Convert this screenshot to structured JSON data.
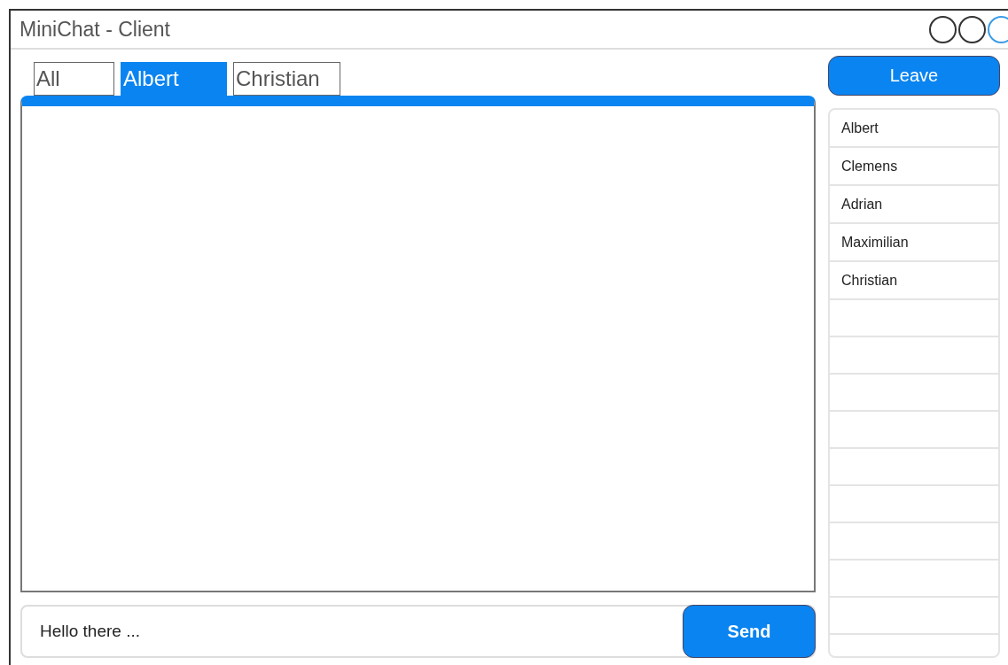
{
  "window": {
    "title": "MiniChat - Client"
  },
  "tabs": [
    {
      "label": "All",
      "selected": false
    },
    {
      "label": "Albert",
      "selected": true
    },
    {
      "label": "Christian",
      "selected": false
    }
  ],
  "leave_button": "Leave",
  "users": [
    "Albert",
    "Clemens",
    "Adrian",
    "Maximilian",
    "Christian"
  ],
  "message": {
    "value": "Hello there ..."
  },
  "send_button": "Send"
}
